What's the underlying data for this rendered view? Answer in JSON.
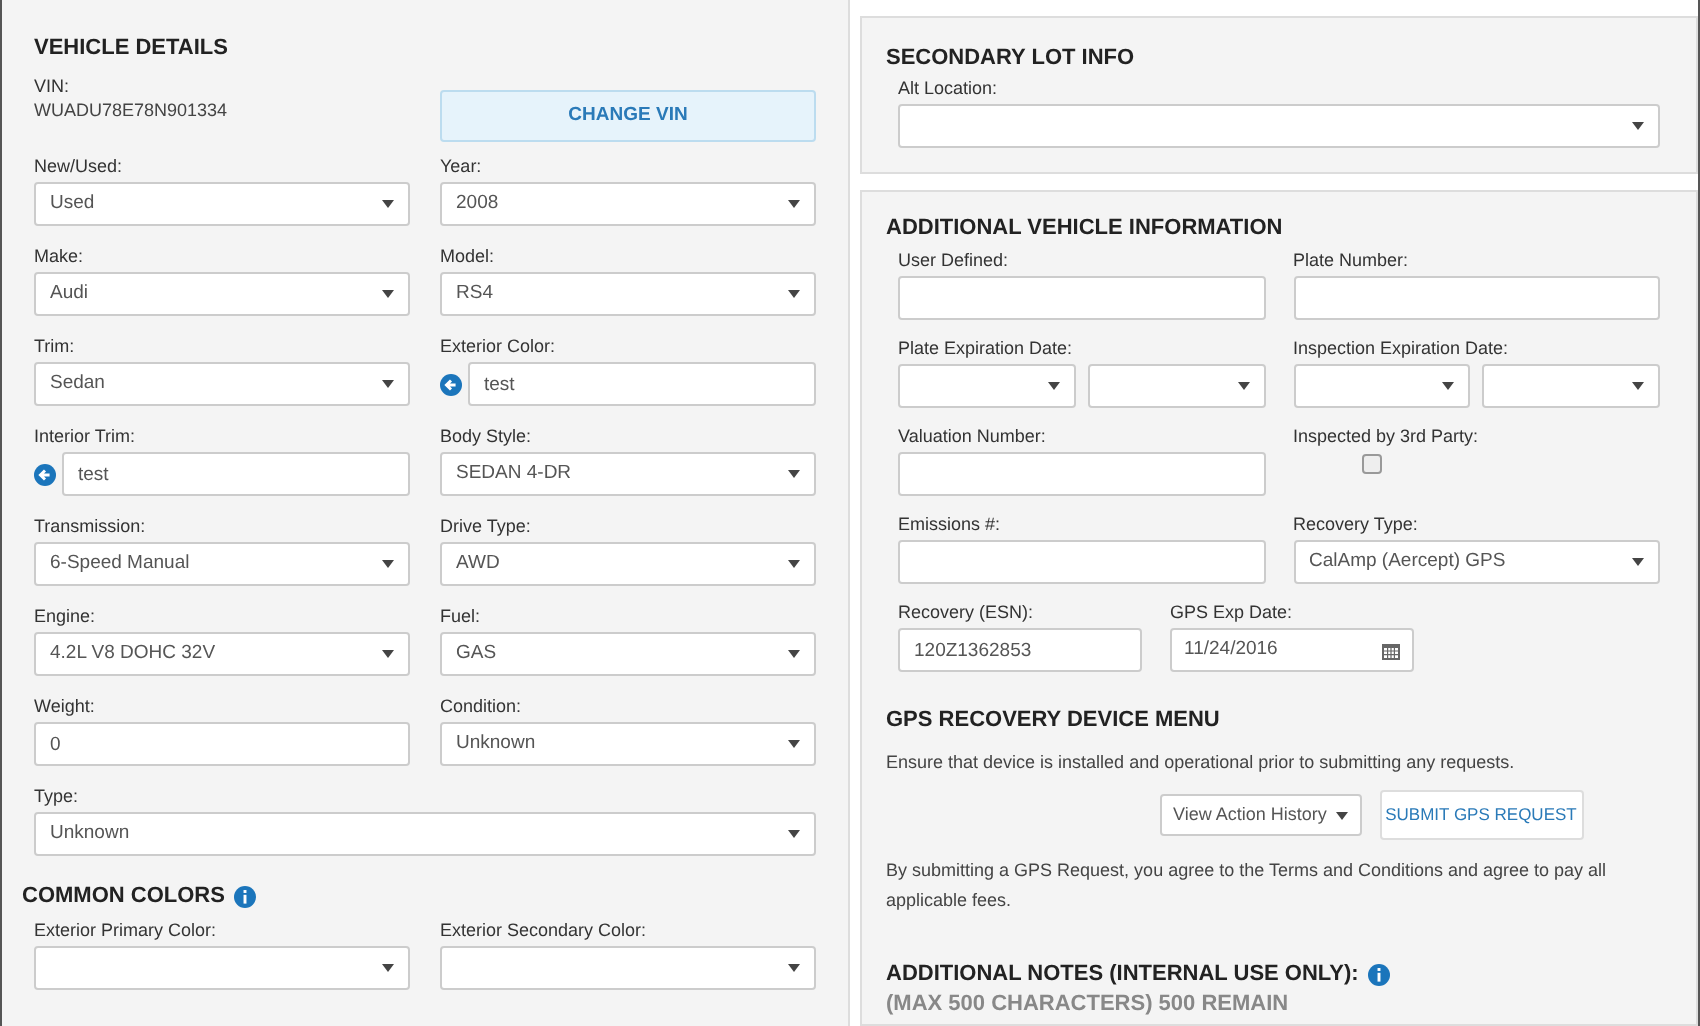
{
  "vehicle_details": {
    "title": "VEHICLE DETAILS",
    "vin_label": "VIN:",
    "vin": "WUADU78E78N901334",
    "change_vin_button": "CHANGE VIN",
    "fields": [
      {
        "label": "New/Used:",
        "kind": "select",
        "value": "Used"
      },
      {
        "label": "Year:",
        "kind": "select",
        "value": "2008"
      },
      {
        "label": "Make:",
        "kind": "select",
        "value": "Audi"
      },
      {
        "label": "Model:",
        "kind": "select",
        "value": "RS4"
      },
      {
        "label": "Trim:",
        "kind": "select",
        "value": "Sedan"
      },
      {
        "label": "Exterior Color:",
        "kind": "icon_text",
        "value": "test"
      },
      {
        "label": "Interior Trim:",
        "kind": "icon_text",
        "value": "test"
      },
      {
        "label": "Body Style:",
        "kind": "select",
        "value": "SEDAN 4-DR"
      },
      {
        "label": "Transmission:",
        "kind": "select",
        "value": "6-Speed Manual"
      },
      {
        "label": "Drive Type:",
        "kind": "select",
        "value": "AWD"
      },
      {
        "label": "Engine:",
        "kind": "select",
        "value": "4.2L V8 DOHC 32V"
      },
      {
        "label": "Fuel:",
        "kind": "select",
        "value": "GAS"
      },
      {
        "label": "Weight:",
        "kind": "text",
        "value": "0"
      },
      {
        "label": "Condition:",
        "kind": "select",
        "value": "Unknown"
      },
      {
        "label": "Type:",
        "kind": "select",
        "value": "Unknown",
        "full": true
      }
    ]
  },
  "common_colors": {
    "title": "COMMON COLORS",
    "fields": [
      {
        "label": "Exterior Primary Color:",
        "kind": "select"
      },
      {
        "label": "Exterior Secondary Color:",
        "kind": "select"
      }
    ]
  },
  "secondary_lot_info": {
    "title": "SECONDARY LOT INFO",
    "fields": [
      {
        "label": "Alt Location:",
        "kind": "select",
        "full": true
      }
    ]
  },
  "additional_vehicle_information": {
    "title": "ADDITIONAL VEHICLE INFORMATION",
    "rows": [
      {
        "compact": false,
        "fields": [
          {
            "label": "User Defined:",
            "kind": "text"
          },
          {
            "label": "Plate Number:",
            "kind": "text"
          }
        ]
      },
      {
        "compact": false,
        "fields": [
          {
            "label": "Plate Expiration Date:",
            "kind": "double_select"
          },
          {
            "label": "Inspection Expiration Date:",
            "kind": "double_select"
          }
        ]
      },
      {
        "compact": false,
        "fields": [
          {
            "label": "Valuation Number:",
            "kind": "text"
          },
          {
            "label": "Inspected by 3rd Party:",
            "kind": "checkbox",
            "checked": false
          }
        ]
      },
      {
        "compact": false,
        "fields": [
          {
            "label": "Emissions #:",
            "kind": "text"
          },
          {
            "label": "Recovery Type:",
            "kind": "select",
            "value": "CalAmp (Aercept) GPS"
          }
        ]
      },
      {
        "compact": true,
        "fields": [
          {
            "label": "Recovery (ESN):",
            "kind": "text",
            "value": "120Z1362853"
          },
          {
            "label": "GPS Exp Date:",
            "kind": "date",
            "value": "11/24/2016"
          }
        ]
      }
    ]
  },
  "gps_recovery_device_menu": {
    "title": "GPS RECOVERY DEVICE MENU",
    "note": "Ensure that device is installed and operational prior to submitting any requests.",
    "action_dropdown": "View Action History",
    "submit_button": "SUBMIT GPS REQUEST",
    "agreement": "By submitting a GPS Request, you agree to the Terms and Conditions and agree to pay all applicable fees."
  },
  "additional_notes": {
    "title": "ADDITIONAL NOTES (INTERNAL USE ONLY):",
    "counter": "(MAX 500 CHARACTERS) 500 REMAIN"
  }
}
